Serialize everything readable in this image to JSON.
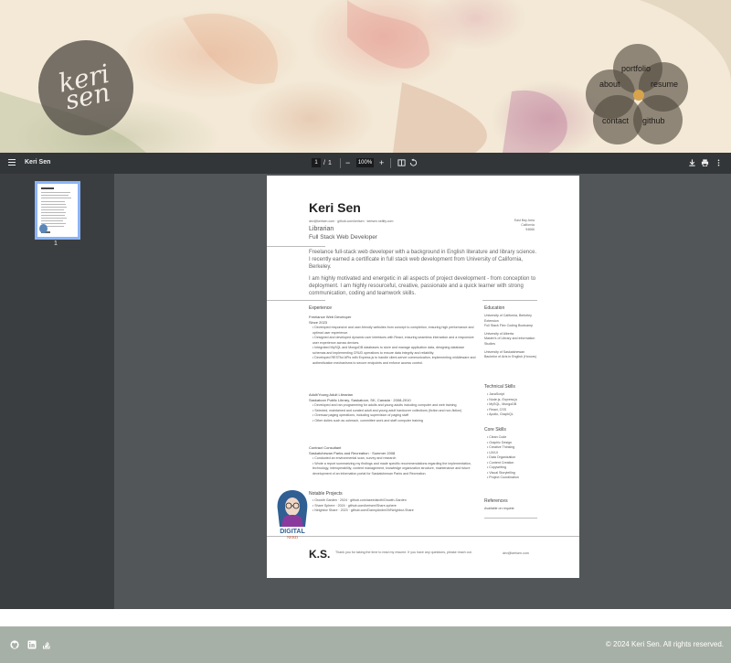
{
  "logo": {
    "line1": "keri",
    "line2": "sen"
  },
  "nav": {
    "portfolio": "portfolio",
    "about": "about",
    "resume": "resume",
    "contact": "contact",
    "github": "github"
  },
  "viewer": {
    "title": "Keri Sen",
    "current_page": "1",
    "page_separator": "/",
    "total_pages": "1",
    "zoom": "100%",
    "zoom_out": "−",
    "zoom_in": "+",
    "thumb_page": "1"
  },
  "resume": {
    "name": "Keri Sen",
    "contact": "dev@kerisen.com · github.com/kerisen · kerisen.netlify.com",
    "location": [
      "East Bay Area",
      "California",
      "94666"
    ],
    "role1": "Librarian",
    "role2": "Full Stack Web Developer",
    "summary1": "Freelance full-stack web developer with a background in English literature and library science. I recently earned a certificate in full stack web development from University of California, Berkeley.",
    "summary2": "I am highly motivated and energetic in all aspects of project development - from conception to deployment. I am highly resourceful, creative, passionate and a quick learner with strong communication, coding and teamwork skills.",
    "experience_heading": "Experience",
    "job1_title": "Freelance Web Developer",
    "job1_dates": "Since 2023",
    "job1_bullets": [
      "Developed responsive and user-friendly websites from concept to completion, ensuring high performance and optimal user experience.",
      "Designed and developed dynamic user interfaces with React, ensuring seamless interaction and a responsive user experience across devices.",
      "Integrated MySQL and MongoDB databases to store and manage application data, designing database schemas and implementing CRUD operations to ensure data integrity and reliability.",
      "Developed RESTful APIs with Express.js to handle client-server communication, implementing middleware and authentication mechanisms to secure endpoints and enforce access control."
    ],
    "job2_title": "Adult/Young Adult Librarian",
    "job2_org": "Saskatoon Public Library, Saskatoon, SK, Canada · 2008-2010",
    "job2_bullets": [
      "Developed and ran programming for adults and young adults including computer and web training",
      "Selected, maintained and curated adult and young adult hardcover collections (fiction and non-fiction)",
      "Oversaw paging operations, including supervision of paging staff",
      "Other duties such as outreach, committee work and staff computer training"
    ],
    "job3_title": "Contract Consultant",
    "job3_org": "Saskatchewan Parks and Recreation · Summer 2008",
    "job3_bullets": [
      "Conducted an environmental scan, survey and research",
      "Wrote a report summarizing my findings and made specific recommendations regarding the implementation, technology, interoperability, content management, knowledge organization structure, maintenance and future development of an information portal for Saskatchewan Parks and Recreation."
    ],
    "projects_heading": "Notable Projects",
    "projects": [
      "Growth Garden · 2024 · github.com/aseedsixth/Growth-Garden",
      "Share Sphere · 2024 · github.com/kerisen/Share-sphere",
      "Neighbor Share · 2023 · github.com/DannyAndre29/Neighbor-Share"
    ],
    "education_heading": "Education",
    "education": [
      "University of California, Berkeley Extension",
      "Full Stack Flex Coding Bootcamp",
      "University of Alberta",
      "Master's of Library and Information Studies",
      "University of Saskatchewan",
      "Bachelor of Arts in English (Honors)"
    ],
    "tech_heading": "Technical Skills",
    "tech": [
      "JavaScript",
      "Node.js, Express.js",
      "MySQL, MongoDB",
      "React, CSS",
      "Apollo, GraphQL"
    ],
    "core_heading": "Core Skills",
    "core": [
      "Clean Code",
      "Graphic Design",
      "Creative Thinking",
      "UX/UI",
      "Data Organization",
      "Content Creation",
      "Copywriting",
      "Visual Storytelling",
      "Project Coordination"
    ],
    "references_heading": "References",
    "references": "Available on request",
    "initials": "K.S.",
    "thanks": "Thank you for taking the time to read my resume. If you have any questions, please reach out.",
    "email": "dev@kerisen.com",
    "badge_line1": "DIGITAL",
    "badge_line2": "NERD"
  },
  "footer": {
    "copyright": "© 2024 Keri Sen. All rights reserved."
  },
  "icons": [
    "github-icon",
    "linkedin-icon",
    "stackoverflow-icon"
  ],
  "colors": {
    "accent": "#d7a34c",
    "viewer_toolbar": "#323639",
    "footer": "#a7b0a6"
  }
}
